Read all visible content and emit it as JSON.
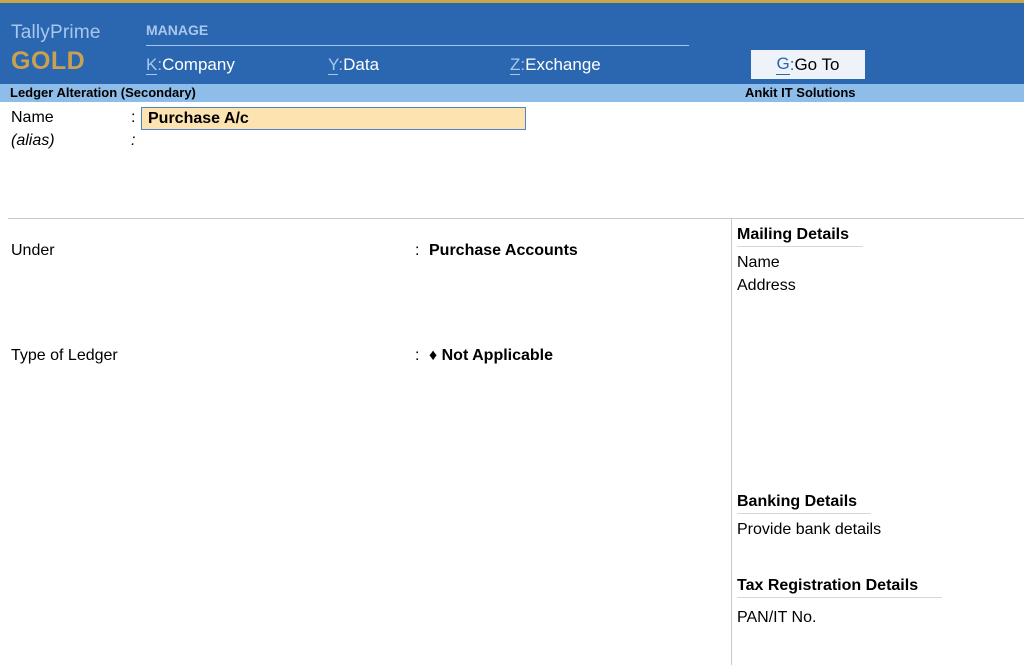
{
  "brand": {
    "name": "TallyPrime",
    "edition": "GOLD"
  },
  "menu": {
    "section_label": "MANAGE",
    "items": [
      {
        "key": "K",
        "label": "Company"
      },
      {
        "key": "Y",
        "label": "Data"
      },
      {
        "key": "Z",
        "label": "Exchange"
      }
    ],
    "goto": {
      "key": "G",
      "label": "Go To"
    }
  },
  "title_bar": {
    "screen": "Ledger Alteration (Secondary)",
    "company": "Ankit IT Solutions"
  },
  "form": {
    "name_label": "Name",
    "name_value": "Purchase A/c",
    "alias_label": "(alias)",
    "separator": ":",
    "under_label": "Under",
    "under_value": "Purchase Accounts",
    "type_label": "Type of Ledger",
    "type_value": "♦ Not Applicable"
  },
  "right_panel": {
    "mailing_heading": "Mailing Details",
    "mailing_name": "Name",
    "mailing_address": "Address",
    "banking_heading": "Banking Details",
    "banking_text": "Provide bank details",
    "tax_heading": "Tax Registration Details",
    "pan_label": "PAN/IT No."
  },
  "colors": {
    "header_bg": "#2b67b1",
    "title_bar_bg": "#8dbde8",
    "input_bg": "#fde3b0",
    "edition_gold": "#c9a24f"
  }
}
